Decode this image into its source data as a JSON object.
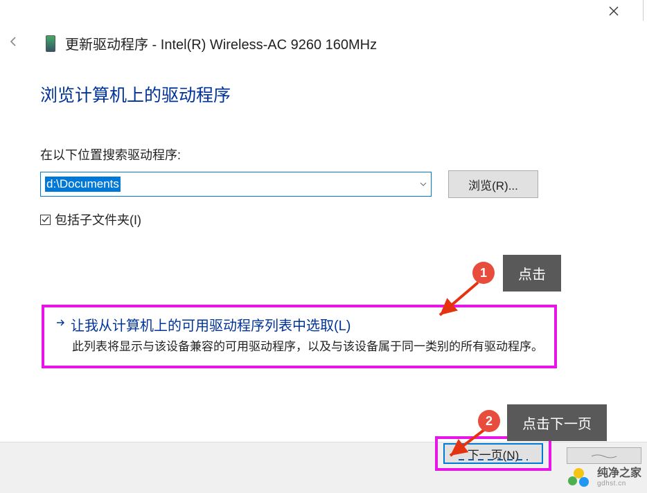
{
  "window": {
    "title_prefix": "更新驱动程序 - ",
    "device_name": "Intel(R) Wireless-AC 9260 160MHz"
  },
  "page": {
    "heading": "浏览计算机上的驱动程序",
    "search_label": "在以下位置搜索驱动程序:",
    "path_value": "d:\\Documents",
    "browse_button": "浏览(R)...",
    "include_subfolders_label": "包括子文件夹(I)",
    "include_subfolders_checked": true
  },
  "option": {
    "title": "让我从计算机上的可用驱动程序列表中选取(L)",
    "description": "此列表将显示与该设备兼容的可用驱动程序，以及与该设备属于同一类别的所有驱动程序。"
  },
  "footer": {
    "next_button": "下一页(N)",
    "cancel_button": "取消"
  },
  "annotations": {
    "step1_badge": "1",
    "step1_text": "点击",
    "step2_badge": "2",
    "step2_text": "点击下一页"
  },
  "watermark": {
    "name": "纯净之家",
    "url": "gdhst.cn"
  }
}
